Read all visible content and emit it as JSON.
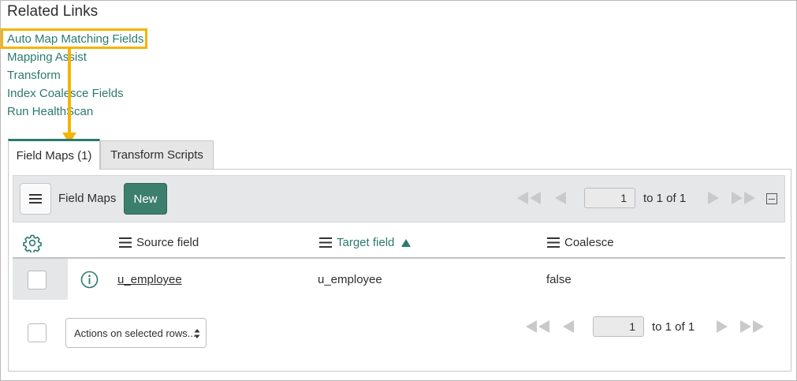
{
  "section_title": "Related Links",
  "related_links": [
    "Auto Map Matching Fields",
    "Mapping Assist",
    "Transform",
    "Index Coalesce Fields",
    "Run HealthScan"
  ],
  "tabs": [
    {
      "label": "Field Maps (1)",
      "active": true
    },
    {
      "label": "Transform Scripts",
      "active": false
    }
  ],
  "toolbar": {
    "title": "Field Maps",
    "new_label": "New",
    "page_value": "1",
    "page_range": "to 1 of 1"
  },
  "table": {
    "columns": [
      "Source field",
      "Target field",
      "Coalesce"
    ],
    "sorted_column": "Target field",
    "sort_direction": "ascending",
    "rows": [
      {
        "source": "u_employee",
        "target": "u_employee",
        "coalesce": "false"
      }
    ]
  },
  "footer": {
    "actions_label": "Actions on selected rows...",
    "page_value": "1",
    "page_range": "to 1 of 1"
  },
  "colors": {
    "accent": "#2b7a6f",
    "new_button": "#3d7f6d",
    "highlight": "#f5b400",
    "toolbar_bg": "#e5e7e9"
  },
  "icons": [
    "hamburger-icon",
    "first-page-icon",
    "prev-page-icon",
    "next-page-icon",
    "last-page-icon",
    "collapse-icon",
    "gear-icon",
    "column-menu-icon",
    "sort-ascending-icon",
    "info-icon",
    "select-caret-icon"
  ]
}
